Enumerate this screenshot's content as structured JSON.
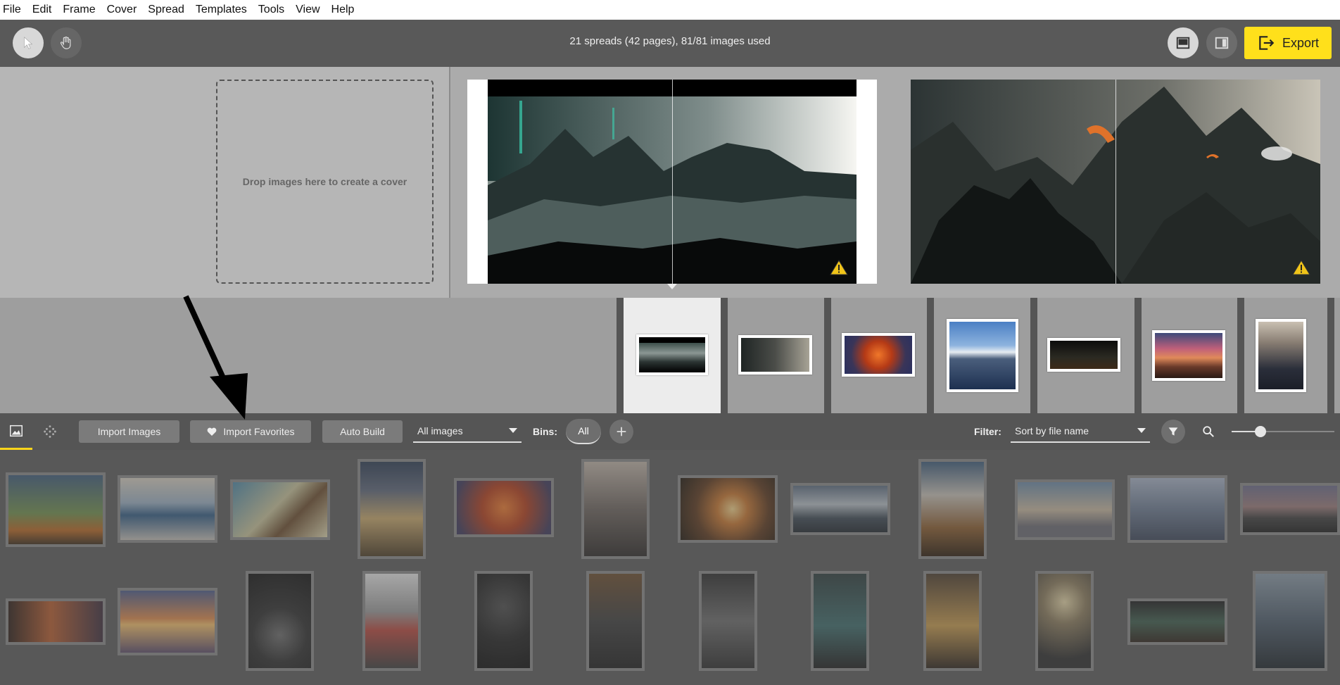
{
  "menu": [
    "File",
    "Edit",
    "Frame",
    "Cover",
    "Spread",
    "Templates",
    "Tools",
    "View",
    "Help"
  ],
  "toolbar": {
    "status": "21 spreads (42 pages), 81/81 images used",
    "export_label": "Export"
  },
  "cover": {
    "drop_text": "Drop images here to create a cover"
  },
  "bin_toolbar": {
    "import_images": "Import Images",
    "import_favorites": "Import Favorites",
    "auto_build": "Auto Build",
    "images_dropdown": "All images",
    "bins_label": "Bins:",
    "bin_all": "All",
    "filter_label": "Filter:",
    "sort_dropdown": "Sort by file name"
  },
  "colors": {
    "accent": "#ffe01b",
    "warning": "#f0c419"
  }
}
